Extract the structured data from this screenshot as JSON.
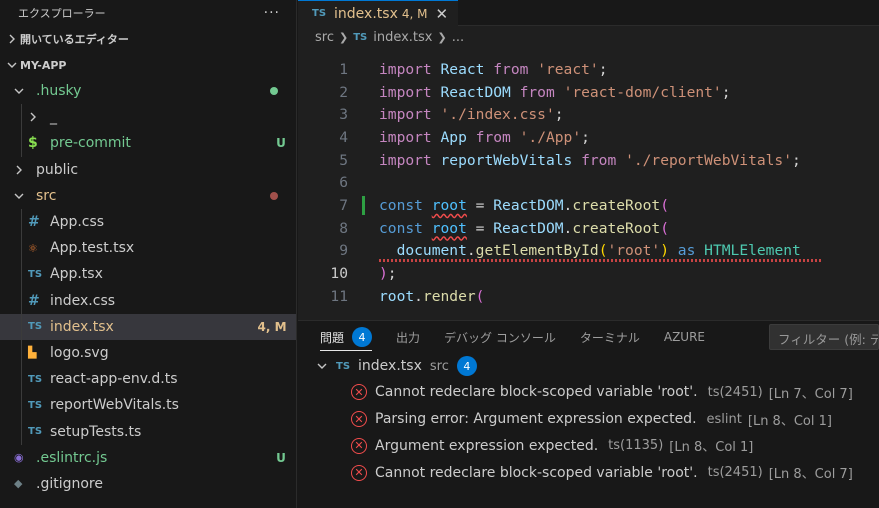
{
  "colors": {
    "accent": "#0078d4",
    "modified": "#e2c08d",
    "untracked": "#73c991",
    "error": "#f14c4c",
    "ts_icon": "#519aba"
  },
  "explorer": {
    "title": "エクスプローラー",
    "more": "···",
    "open_editors": "開いているエディター",
    "project": "MY-APP"
  },
  "tree": [
    {
      "label": ".husky",
      "icon": "chevron-down-icon",
      "indent": 0,
      "color": "#73c991",
      "dot": "#73c991"
    },
    {
      "label": "_",
      "icon": "chevron-right-icon",
      "indent": 1,
      "color": "#cccccc"
    },
    {
      "label": "pre-commit",
      "icon": "shell-file-icon",
      "indent": 1,
      "color": "#73c991",
      "badge": "U"
    },
    {
      "label": "public",
      "icon": "chevron-right-icon",
      "indent": 0,
      "color": "#cccccc"
    },
    {
      "label": "src",
      "icon": "chevron-down-icon",
      "indent": 0,
      "color": "#e2c08d",
      "dot": "#a1504b"
    },
    {
      "label": "App.css",
      "icon": "css-file-icon",
      "indent": 1,
      "color": "#cccccc"
    },
    {
      "label": "App.test.tsx",
      "icon": "react-file-icon",
      "indent": 1,
      "color": "#cccccc"
    },
    {
      "label": "App.tsx",
      "icon": "ts-file-icon",
      "indent": 1,
      "color": "#cccccc"
    },
    {
      "label": "index.css",
      "icon": "css-file-icon",
      "indent": 1,
      "color": "#cccccc"
    },
    {
      "label": "index.tsx",
      "icon": "ts-file-icon",
      "indent": 1,
      "color": "#e2c08d",
      "badge": "4, M",
      "selected": true
    },
    {
      "label": "logo.svg",
      "icon": "svg-file-icon",
      "indent": 1,
      "color": "#cccccc"
    },
    {
      "label": "react-app-env.d.ts",
      "icon": "ts-file-icon",
      "indent": 1,
      "color": "#cccccc"
    },
    {
      "label": "reportWebVitals.ts",
      "icon": "ts-file-icon",
      "indent": 1,
      "color": "#cccccc"
    },
    {
      "label": "setupTests.ts",
      "icon": "ts-file-icon",
      "indent": 1,
      "color": "#cccccc"
    },
    {
      "label": ".eslintrc.js",
      "icon": "eslint-file-icon",
      "indent": 0,
      "color": "#73c991",
      "badge": "U"
    },
    {
      "label": ".gitignore",
      "icon": "git-file-icon",
      "indent": 0,
      "color": "#cccccc"
    }
  ],
  "tab": {
    "icon_text": "TS",
    "filename": "index.tsx",
    "badge": "4, M",
    "close": "✕"
  },
  "breadcrumb": {
    "folder": "src",
    "icon_text": "TS",
    "file": "index.tsx",
    "more": "..."
  },
  "code_lines": [
    {
      "n": "1",
      "tokens": [
        [
          "kw2",
          "import"
        ],
        [
          "pl",
          " "
        ],
        [
          "id",
          "React"
        ],
        [
          "pl",
          " "
        ],
        [
          "kw2",
          "from"
        ],
        [
          "pl",
          " "
        ],
        [
          "str",
          "'react'"
        ],
        [
          "pl",
          ";"
        ]
      ]
    },
    {
      "n": "2",
      "tokens": [
        [
          "kw2",
          "import"
        ],
        [
          "pl",
          " "
        ],
        [
          "id",
          "ReactDOM"
        ],
        [
          "pl",
          " "
        ],
        [
          "kw2",
          "from"
        ],
        [
          "pl",
          " "
        ],
        [
          "str",
          "'react-dom/client'"
        ],
        [
          "pl",
          ";"
        ]
      ]
    },
    {
      "n": "3",
      "tokens": [
        [
          "kw2",
          "import"
        ],
        [
          "pl",
          " "
        ],
        [
          "str",
          "'./index.css'"
        ],
        [
          "pl",
          ";"
        ]
      ]
    },
    {
      "n": "4",
      "tokens": [
        [
          "kw2",
          "import"
        ],
        [
          "pl",
          " "
        ],
        [
          "id",
          "App"
        ],
        [
          "pl",
          " "
        ],
        [
          "kw2",
          "from"
        ],
        [
          "pl",
          " "
        ],
        [
          "str",
          "'./App'"
        ],
        [
          "pl",
          ";"
        ]
      ]
    },
    {
      "n": "5",
      "tokens": [
        [
          "kw2",
          "import"
        ],
        [
          "pl",
          " "
        ],
        [
          "id",
          "reportWebVitals"
        ],
        [
          "pl",
          " "
        ],
        [
          "kw2",
          "from"
        ],
        [
          "pl",
          " "
        ],
        [
          "str",
          "'./reportWebVitals'"
        ],
        [
          "pl",
          ";"
        ]
      ]
    },
    {
      "n": "6",
      "tokens": []
    },
    {
      "n": "7",
      "mod": true,
      "tokens": [
        [
          "kw",
          "const"
        ],
        [
          "pl",
          " "
        ],
        [
          "var squig",
          "root"
        ],
        [
          "pl",
          " = "
        ],
        [
          "id",
          "ReactDOM"
        ],
        [
          "pl",
          "."
        ],
        [
          "fn",
          "createRoot"
        ],
        [
          "br1",
          "("
        ]
      ]
    },
    {
      "n": "8",
      "tokens": [
        [
          "kw",
          "const"
        ],
        [
          "pl",
          " "
        ],
        [
          "var squig",
          "root"
        ],
        [
          "pl",
          " = "
        ],
        [
          "id",
          "ReactDOM"
        ],
        [
          "pl",
          "."
        ],
        [
          "fn",
          "createRoot"
        ],
        [
          "br1",
          "("
        ]
      ]
    },
    {
      "n": "9",
      "squig_line": true,
      "tokens": [
        [
          "pl",
          "  "
        ],
        [
          "id",
          "document"
        ],
        [
          "pl",
          "."
        ],
        [
          "fn",
          "getElementById"
        ],
        [
          "br2",
          "("
        ],
        [
          "str",
          "'root'"
        ],
        [
          "br2",
          ")"
        ],
        [
          "pl",
          " "
        ],
        [
          "kw",
          "as"
        ],
        [
          "pl",
          " "
        ],
        [
          "cls",
          "HTMLElement"
        ]
      ]
    },
    {
      "n": "10",
      "cur": true,
      "tokens": [
        [
          "br1",
          ")"
        ],
        [
          "pl",
          ";"
        ]
      ]
    },
    {
      "n": "11",
      "tokens": [
        [
          "id",
          "root"
        ],
        [
          "pl",
          "."
        ],
        [
          "fn",
          "render"
        ],
        [
          "br1",
          "("
        ]
      ]
    }
  ],
  "panel": {
    "tabs": [
      "問題",
      "出力",
      "デバッグ コンソール",
      "ターミナル",
      "AZURE"
    ],
    "problem_count": "4",
    "filter_placeholder": "フィルター (例: テキスト",
    "file": {
      "icon_text": "TS",
      "name": "index.tsx",
      "folder": "src",
      "count": "4"
    },
    "problems": [
      {
        "message": "Cannot redeclare block-scoped variable 'root'.",
        "source": "ts(2451)",
        "position": "[Ln 7、Col 7]"
      },
      {
        "message": "Parsing error: Argument expression expected.",
        "source": "eslint",
        "position": "[Ln 8、Col 1]"
      },
      {
        "message": "Argument expression expected.",
        "source": "ts(1135)",
        "position": "[Ln 8、Col 1]"
      },
      {
        "message": "Cannot redeclare block-scoped variable 'root'.",
        "source": "ts(2451)",
        "position": "[Ln 8、Col 7]"
      }
    ]
  }
}
